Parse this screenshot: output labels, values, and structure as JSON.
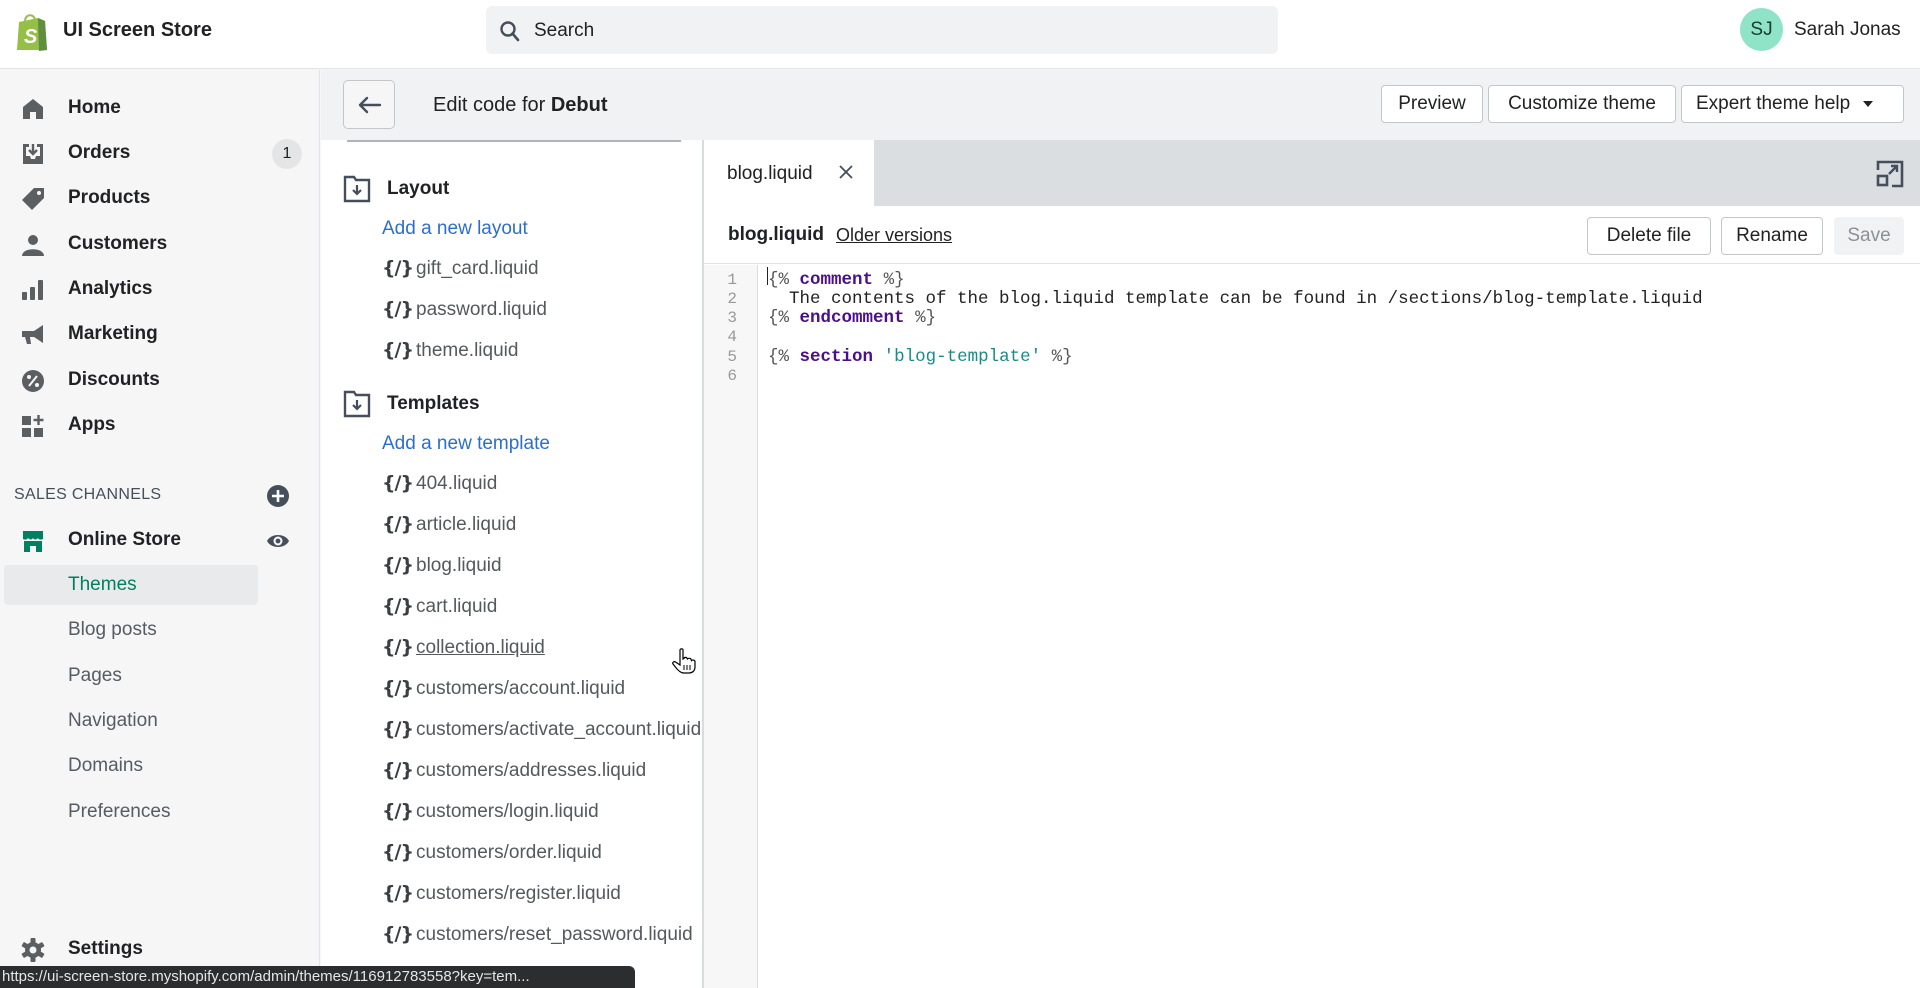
{
  "topbar": {
    "store_name": "UI Screen Store",
    "search_placeholder": "Search",
    "user_initials": "SJ",
    "user_name": "Sarah Jonas",
    "avatar_color": "#8fe3c7"
  },
  "sidebar": {
    "items": [
      {
        "label": "Home",
        "icon": "home-icon"
      },
      {
        "label": "Orders",
        "icon": "orders-icon",
        "badge": "1"
      },
      {
        "label": "Products",
        "icon": "tag-icon"
      },
      {
        "label": "Customers",
        "icon": "person-icon"
      },
      {
        "label": "Analytics",
        "icon": "bar-chart-icon"
      },
      {
        "label": "Marketing",
        "icon": "megaphone-icon"
      },
      {
        "label": "Discounts",
        "icon": "discount-icon"
      },
      {
        "label": "Apps",
        "icon": "apps-icon"
      }
    ],
    "sales_channels_title": "SALES CHANNELS",
    "online_store": "Online Store",
    "sub_items": [
      {
        "label": "Themes",
        "active": true
      },
      {
        "label": "Blog posts"
      },
      {
        "label": "Pages"
      },
      {
        "label": "Navigation"
      },
      {
        "label": "Domains"
      },
      {
        "label": "Preferences"
      }
    ],
    "settings": "Settings",
    "accent_color": "#007f5f"
  },
  "header": {
    "title_prefix": "Edit code for ",
    "theme_name": "Debut",
    "buttons": {
      "preview": "Preview",
      "customize": "Customize theme",
      "expert_help": "Expert theme help"
    }
  },
  "filetree": {
    "layout": {
      "label": "Layout",
      "add_link": "Add a new layout",
      "files": [
        "gift_card.liquid",
        "password.liquid",
        "theme.liquid"
      ]
    },
    "templates": {
      "label": "Templates",
      "add_link": "Add a new template",
      "files": [
        "404.liquid",
        "article.liquid",
        "blog.liquid",
        "cart.liquid",
        "collection.liquid",
        "customers/account.liquid",
        "customers/activate_account.liquid",
        "customers/addresses.liquid",
        "customers/login.liquid",
        "customers/order.liquid",
        "customers/register.liquid",
        "customers/reset_password.liquid"
      ],
      "hovered_file": "collection.liquid"
    },
    "file_icon_glyph": "{/}",
    "link_color": "#2c6ecb"
  },
  "editor": {
    "tab_label": "blog.liquid",
    "file_name": "blog.liquid",
    "older_versions": "Older versions",
    "buttons": {
      "delete": "Delete file",
      "rename": "Rename",
      "save": "Save"
    },
    "line_numbers": [
      "1",
      "2",
      "3",
      "4",
      "5",
      "6"
    ],
    "code": {
      "l1_open": "{%",
      "l1_kw": "comment",
      "l1_close": "%}",
      "l2_text": "  The contents of the blog.liquid template can be found in /sections/blog-template.liquid",
      "l3_open": "{%",
      "l3_kw": "endcomment",
      "l3_close": "%}",
      "l5_open": "{%",
      "l5_kw": "section",
      "l5_str": "'blog-template'",
      "l5_close": "%}"
    }
  },
  "status_bar": {
    "url": "https://ui-screen-store.myshopify.com/admin/themes/116912783558?key=tem..."
  }
}
